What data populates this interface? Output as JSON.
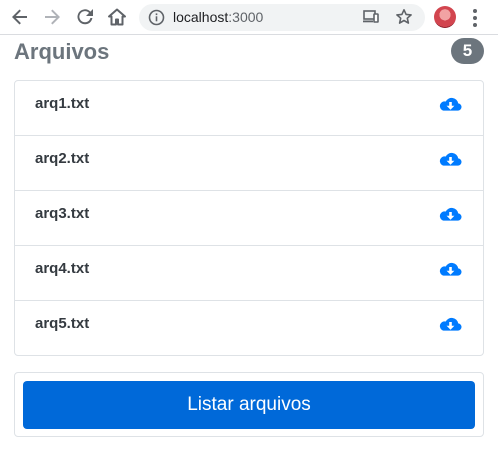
{
  "browser": {
    "url_host": "localhost",
    "url_port": ":3000",
    "icons": [
      "back-icon",
      "forward-icon",
      "reload-icon",
      "home-icon",
      "info-icon",
      "cast-icon",
      "star-icon",
      "avatar",
      "menu-icon"
    ]
  },
  "header": {
    "title": "Arquivos",
    "count": "5"
  },
  "files": [
    {
      "name": "arq1.txt",
      "icon": "cloud-download-icon"
    },
    {
      "name": "arq2.txt",
      "icon": "cloud-download-icon"
    },
    {
      "name": "arq3.txt",
      "icon": "cloud-download-icon"
    },
    {
      "name": "arq4.txt",
      "icon": "cloud-download-icon"
    },
    {
      "name": "arq5.txt",
      "icon": "cloud-download-icon"
    }
  ],
  "actions": {
    "list_label": "Listar arquivos"
  },
  "colors": {
    "primary": "#0069d9",
    "download_icon": "#007bff",
    "badge": "#6c757d",
    "title": "#6c757d",
    "border": "#dee2e6"
  }
}
